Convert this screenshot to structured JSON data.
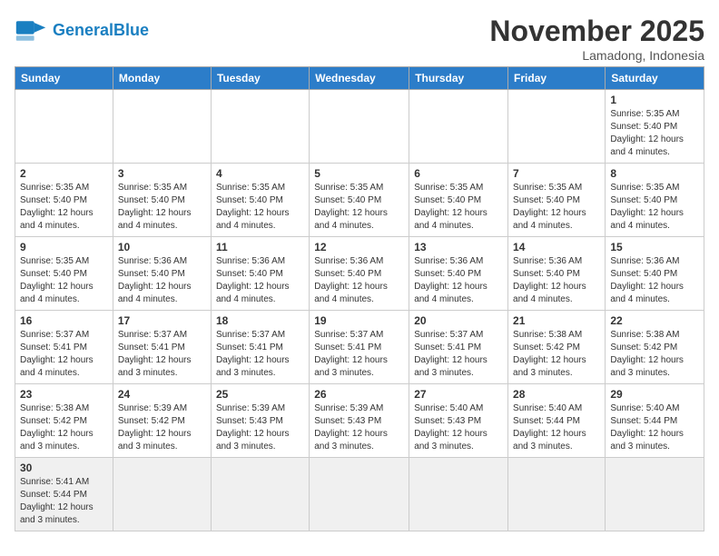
{
  "header": {
    "logo_general": "General",
    "logo_blue": "Blue",
    "month_year": "November 2025",
    "location": "Lamadong, Indonesia"
  },
  "weekdays": [
    "Sunday",
    "Monday",
    "Tuesday",
    "Wednesday",
    "Thursday",
    "Friday",
    "Saturday"
  ],
  "weeks": [
    [
      {
        "day": "",
        "info": ""
      },
      {
        "day": "",
        "info": ""
      },
      {
        "day": "",
        "info": ""
      },
      {
        "day": "",
        "info": ""
      },
      {
        "day": "",
        "info": ""
      },
      {
        "day": "",
        "info": ""
      },
      {
        "day": "1",
        "info": "Sunrise: 5:35 AM\nSunset: 5:40 PM\nDaylight: 12 hours\nand 4 minutes."
      }
    ],
    [
      {
        "day": "2",
        "info": "Sunrise: 5:35 AM\nSunset: 5:40 PM\nDaylight: 12 hours\nand 4 minutes."
      },
      {
        "day": "3",
        "info": "Sunrise: 5:35 AM\nSunset: 5:40 PM\nDaylight: 12 hours\nand 4 minutes."
      },
      {
        "day": "4",
        "info": "Sunrise: 5:35 AM\nSunset: 5:40 PM\nDaylight: 12 hours\nand 4 minutes."
      },
      {
        "day": "5",
        "info": "Sunrise: 5:35 AM\nSunset: 5:40 PM\nDaylight: 12 hours\nand 4 minutes."
      },
      {
        "day": "6",
        "info": "Sunrise: 5:35 AM\nSunset: 5:40 PM\nDaylight: 12 hours\nand 4 minutes."
      },
      {
        "day": "7",
        "info": "Sunrise: 5:35 AM\nSunset: 5:40 PM\nDaylight: 12 hours\nand 4 minutes."
      },
      {
        "day": "8",
        "info": "Sunrise: 5:35 AM\nSunset: 5:40 PM\nDaylight: 12 hours\nand 4 minutes."
      }
    ],
    [
      {
        "day": "9",
        "info": "Sunrise: 5:35 AM\nSunset: 5:40 PM\nDaylight: 12 hours\nand 4 minutes."
      },
      {
        "day": "10",
        "info": "Sunrise: 5:36 AM\nSunset: 5:40 PM\nDaylight: 12 hours\nand 4 minutes."
      },
      {
        "day": "11",
        "info": "Sunrise: 5:36 AM\nSunset: 5:40 PM\nDaylight: 12 hours\nand 4 minutes."
      },
      {
        "day": "12",
        "info": "Sunrise: 5:36 AM\nSunset: 5:40 PM\nDaylight: 12 hours\nand 4 minutes."
      },
      {
        "day": "13",
        "info": "Sunrise: 5:36 AM\nSunset: 5:40 PM\nDaylight: 12 hours\nand 4 minutes."
      },
      {
        "day": "14",
        "info": "Sunrise: 5:36 AM\nSunset: 5:40 PM\nDaylight: 12 hours\nand 4 minutes."
      },
      {
        "day": "15",
        "info": "Sunrise: 5:36 AM\nSunset: 5:40 PM\nDaylight: 12 hours\nand 4 minutes."
      }
    ],
    [
      {
        "day": "16",
        "info": "Sunrise: 5:37 AM\nSunset: 5:41 PM\nDaylight: 12 hours\nand 4 minutes."
      },
      {
        "day": "17",
        "info": "Sunrise: 5:37 AM\nSunset: 5:41 PM\nDaylight: 12 hours\nand 3 minutes."
      },
      {
        "day": "18",
        "info": "Sunrise: 5:37 AM\nSunset: 5:41 PM\nDaylight: 12 hours\nand 3 minutes."
      },
      {
        "day": "19",
        "info": "Sunrise: 5:37 AM\nSunset: 5:41 PM\nDaylight: 12 hours\nand 3 minutes."
      },
      {
        "day": "20",
        "info": "Sunrise: 5:37 AM\nSunset: 5:41 PM\nDaylight: 12 hours\nand 3 minutes."
      },
      {
        "day": "21",
        "info": "Sunrise: 5:38 AM\nSunset: 5:42 PM\nDaylight: 12 hours\nand 3 minutes."
      },
      {
        "day": "22",
        "info": "Sunrise: 5:38 AM\nSunset: 5:42 PM\nDaylight: 12 hours\nand 3 minutes."
      }
    ],
    [
      {
        "day": "23",
        "info": "Sunrise: 5:38 AM\nSunset: 5:42 PM\nDaylight: 12 hours\nand 3 minutes."
      },
      {
        "day": "24",
        "info": "Sunrise: 5:39 AM\nSunset: 5:42 PM\nDaylight: 12 hours\nand 3 minutes."
      },
      {
        "day": "25",
        "info": "Sunrise: 5:39 AM\nSunset: 5:43 PM\nDaylight: 12 hours\nand 3 minutes."
      },
      {
        "day": "26",
        "info": "Sunrise: 5:39 AM\nSunset: 5:43 PM\nDaylight: 12 hours\nand 3 minutes."
      },
      {
        "day": "27",
        "info": "Sunrise: 5:40 AM\nSunset: 5:43 PM\nDaylight: 12 hours\nand 3 minutes."
      },
      {
        "day": "28",
        "info": "Sunrise: 5:40 AM\nSunset: 5:44 PM\nDaylight: 12 hours\nand 3 minutes."
      },
      {
        "day": "29",
        "info": "Sunrise: 5:40 AM\nSunset: 5:44 PM\nDaylight: 12 hours\nand 3 minutes."
      }
    ],
    [
      {
        "day": "30",
        "info": "Sunrise: 5:41 AM\nSunset: 5:44 PM\nDaylight: 12 hours\nand 3 minutes."
      },
      {
        "day": "",
        "info": ""
      },
      {
        "day": "",
        "info": ""
      },
      {
        "day": "",
        "info": ""
      },
      {
        "day": "",
        "info": ""
      },
      {
        "day": "",
        "info": ""
      },
      {
        "day": "",
        "info": ""
      }
    ]
  ]
}
